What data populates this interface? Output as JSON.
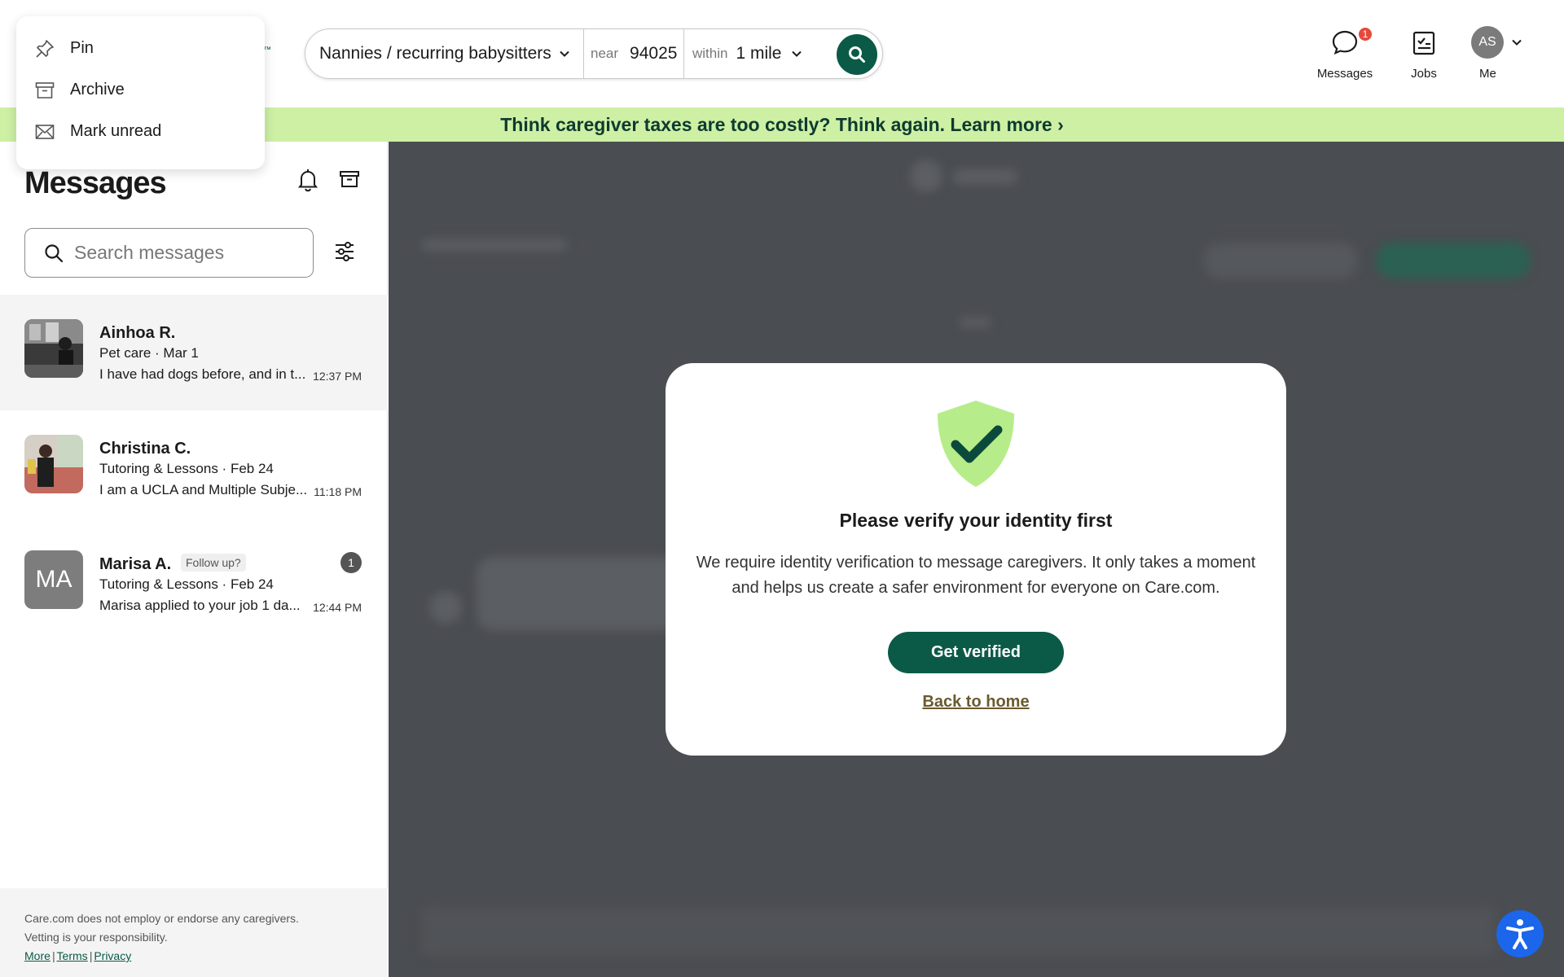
{
  "header": {
    "logo_tm": "™",
    "search": {
      "service": "Nannies / recurring babysitters",
      "near_label": "near",
      "zip": "94025",
      "within_label": "within",
      "distance": "1 mile"
    },
    "nav": {
      "messages_label": "Messages",
      "messages_badge": "1",
      "jobs_label": "Jobs",
      "me_initials": "AS",
      "me_label": "Me"
    }
  },
  "banner": {
    "text": "Think caregiver taxes are too costly? Think again. Learn more ›"
  },
  "context_menu": {
    "items": [
      {
        "label": "Pin",
        "icon": "pin-icon"
      },
      {
        "label": "Archive",
        "icon": "archive-icon"
      },
      {
        "label": "Mark unread",
        "icon": "envelope-icon"
      }
    ]
  },
  "messages": {
    "title": "Messages",
    "search_placeholder": "Search messages",
    "conversations": [
      {
        "name": "Ainhoa R.",
        "sub": "Pet care · Mar 1",
        "preview": "I have had dogs before, and in t...",
        "time": "12:37 PM"
      },
      {
        "name": "Christina C.",
        "sub": "Tutoring & Lessons · Feb 24",
        "preview": "I am a UCLA and Multiple Subje...",
        "time": "11:18 PM"
      },
      {
        "name": "Marisa A.",
        "tag": "Follow up?",
        "initials": "MA",
        "unread": "1",
        "sub": "Tutoring & Lessons · Feb 24",
        "preview": "Marisa applied to your job 1 da...",
        "time": "12:44 PM"
      }
    ]
  },
  "footer": {
    "line1": "Care.com does not employ or endorse any caregivers.",
    "line2": "Vetting is your responsibility.",
    "links": [
      "More",
      "Terms",
      "Privacy"
    ],
    "sep": "|"
  },
  "modal": {
    "title": "Please verify your identity first",
    "body": "We require identity verification to message caregivers. It only takes a moment and helps us create a safer environment for everyone on Care.com.",
    "primary_button": "Get verified",
    "secondary_link": "Back to home"
  },
  "colors": {
    "brand_green": "#0b5a47",
    "banner_green": "#cdf0a5",
    "overlay": "#4a4d51",
    "badge_red": "#e5493a",
    "a11y_blue": "#1b66ea"
  }
}
